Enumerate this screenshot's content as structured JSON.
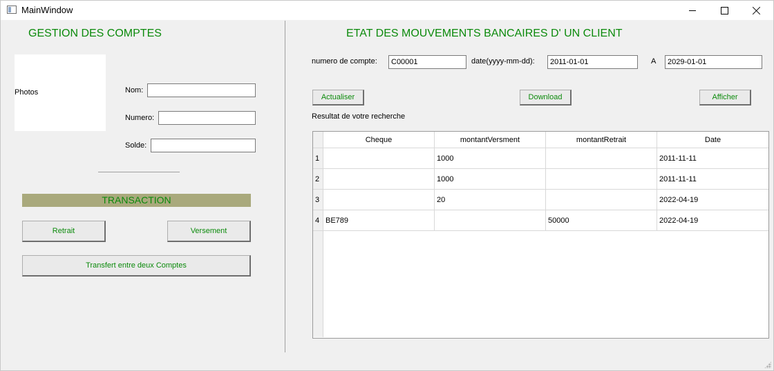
{
  "window": {
    "title": "MainWindow"
  },
  "left": {
    "heading": "GESTION DES COMPTES",
    "photo_label": "Photos",
    "nom_label": "Nom:",
    "nom_value": "",
    "numero_label": "Numero:",
    "numero_value": "",
    "solde_label": "Solde:",
    "solde_value": "",
    "transaction_label": "TRANSACTION",
    "retrait_button": "Retrait",
    "versement_button": "Versement",
    "transfert_button": "Transfert entre deux Comptes"
  },
  "right": {
    "heading": "ETAT DES MOUVEMENTS BANCAIRES D' UN CLIENT",
    "account_label": "numero de compte:",
    "account_value": "C00001",
    "date_label": "date(yyyy-mm-dd):",
    "date_from": "2011-01-01",
    "to_label": "A",
    "date_to": "2029-01-01",
    "actualiser_button": "Actualiser",
    "download_button": "Download",
    "afficher_button": "Afficher",
    "result_label": "Resultat de votre recherche"
  },
  "table": {
    "columns": [
      "Cheque",
      "montantVersment",
      "montantRetrait",
      "Date"
    ],
    "rows": [
      {
        "num": "1",
        "cheque": "",
        "versement": "1000",
        "retrait": "",
        "date": "2011-11-11"
      },
      {
        "num": "2",
        "cheque": "",
        "versement": "1000",
        "retrait": "",
        "date": "2011-11-11"
      },
      {
        "num": "3",
        "cheque": "",
        "versement": "20",
        "retrait": "",
        "date": "2022-04-19"
      },
      {
        "num": "4",
        "cheque": "BE789",
        "versement": "",
        "retrait": "50000",
        "date": "2022-04-19"
      }
    ]
  },
  "colors": {
    "accent_green": "#0b8a0b",
    "transaction_bar": "#a9a97c"
  }
}
